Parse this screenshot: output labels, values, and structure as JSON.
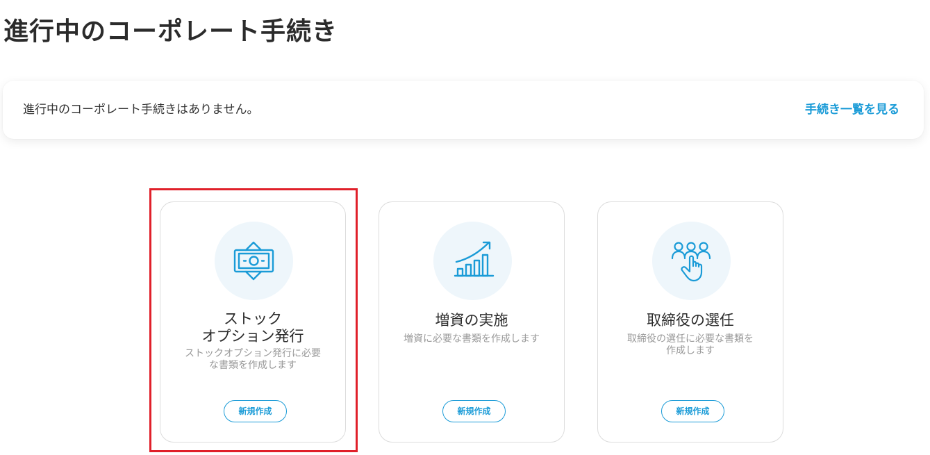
{
  "page": {
    "title": "進行中のコーポレート手続き"
  },
  "info_panel": {
    "message": "進行中のコーポレート手続きはありません。",
    "link_label": "手続き一覧を見る"
  },
  "cards": [
    {
      "title_line1": "ストック",
      "title_line2": "オプション発行",
      "description_line1": "ストックオプション発行に必要",
      "description_line2": "な書類を作成します",
      "button_label": "新規作成",
      "icon": "money-bill-icon"
    },
    {
      "title": "増資の実施",
      "description": "増資に必要な書類を作成します",
      "button_label": "新規作成",
      "icon": "growth-chart-icon"
    },
    {
      "title": "取締役の選任",
      "description_line1": "取締役の選任に必要な書類を",
      "description_line2": "作成します",
      "button_label": "新規作成",
      "icon": "select-person-icon"
    }
  ],
  "colors": {
    "accent": "#1a9bd7",
    "highlight": "#e0202a",
    "icon_bg": "#eef6fb"
  }
}
